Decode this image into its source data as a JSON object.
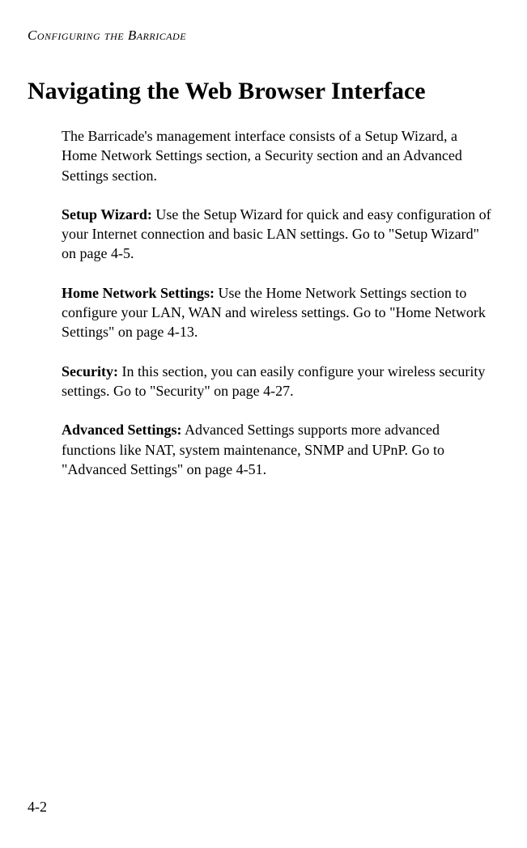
{
  "header": {
    "running_title": "Configuring the Barricade"
  },
  "heading": "Navigating the Web Browser Interface",
  "intro": "The Barricade's management interface consists of a Setup Wizard, a Home Network Settings section, a Security section and an Advanced Settings section.",
  "sections": {
    "setup_wizard": {
      "title": "Setup Wizard:",
      "text": " Use the Setup Wizard for quick and easy configuration of your Internet connection and basic LAN settings. Go to \"Setup Wizard\" on page 4-5."
    },
    "home_network": {
      "title": "Home Network Settings:",
      "text": " Use the Home Network Settings section to configure your LAN, WAN and wireless settings. Go to \"Home Network Settings\" on page 4-13."
    },
    "security": {
      "title": "Security:",
      "text": " In this section, you can easily configure your wireless security settings. Go to \"Security\" on page 4-27."
    },
    "advanced": {
      "title": "Advanced Settings:",
      "text": " Advanced Settings supports more advanced functions like NAT, system maintenance, SNMP and UPnP. Go to \"Advanced Settings\" on page 4-51."
    }
  },
  "page_number": "4-2"
}
